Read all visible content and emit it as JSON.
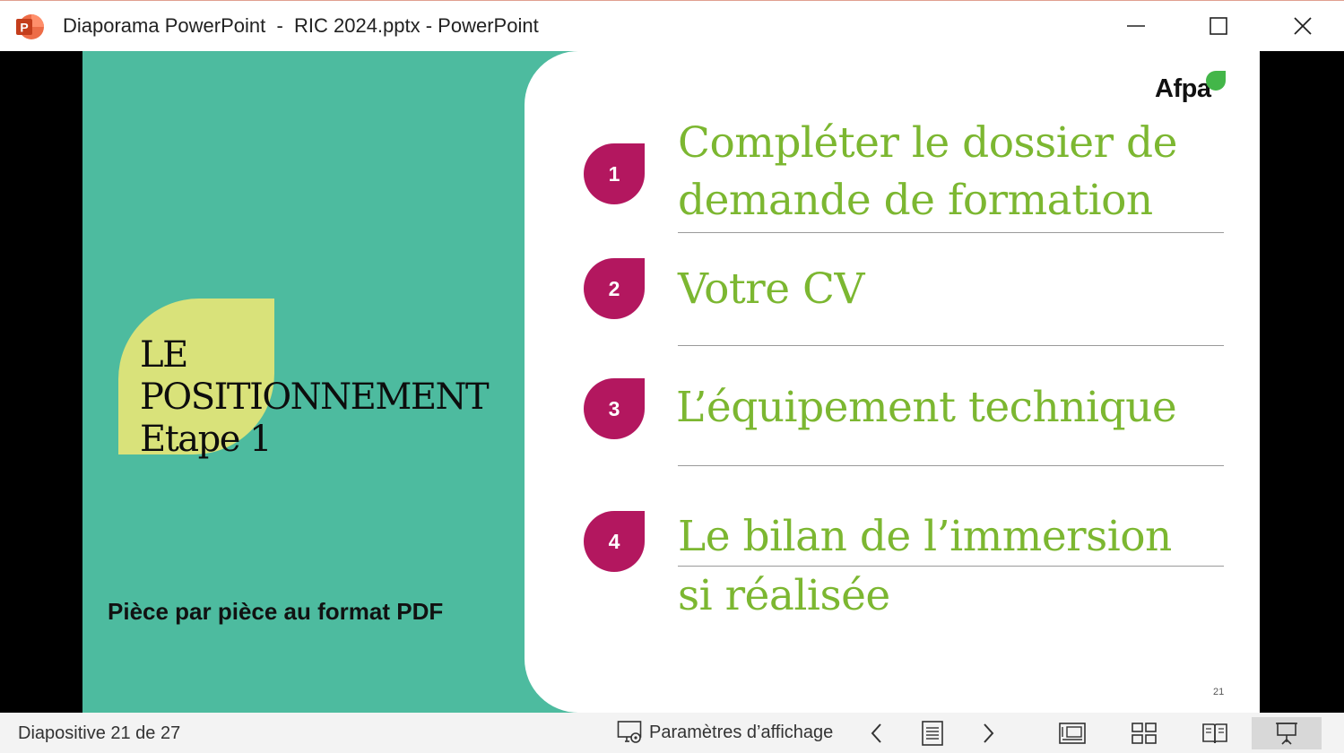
{
  "window": {
    "title": "Diaporama PowerPoint  -  RIC 2024.pptx - PowerPoint",
    "app_icon": "powerpoint-icon",
    "app_icon_letter": "P"
  },
  "slide": {
    "heading_lines": [
      "LE",
      "POSITIONNEMENT",
      "Etape 1"
    ],
    "subtitle": "Pièce par pièce au format PDF",
    "logo": "Afpa",
    "items": [
      {
        "number": "1",
        "text_lines": [
          "Compléter le dossier de",
          "demande de formation"
        ]
      },
      {
        "number": "2",
        "text_lines": [
          "Votre CV"
        ]
      },
      {
        "number": "3",
        "text_lines": [
          "L’équipement technique"
        ]
      },
      {
        "number": "4",
        "text_lines": [
          "Le bilan de l’immersion",
          "si réalisée"
        ]
      }
    ],
    "page_number": "21",
    "colors": {
      "background": "#4dbb9f",
      "leaf": "#d9e27a",
      "badge": "#b3175f",
      "item_text": "#7cb731",
      "logo_dot": "#43b649"
    }
  },
  "statusbar": {
    "slide_counter": "Diapositive 21 de 27",
    "display_settings_label": "Paramètres d’affichage",
    "icons": [
      "display-settings-icon",
      "previous-icon",
      "slide-menu-icon",
      "next-icon",
      "normal-view-icon",
      "slide-sorter-icon",
      "reading-view-icon",
      "slideshow-icon"
    ]
  }
}
